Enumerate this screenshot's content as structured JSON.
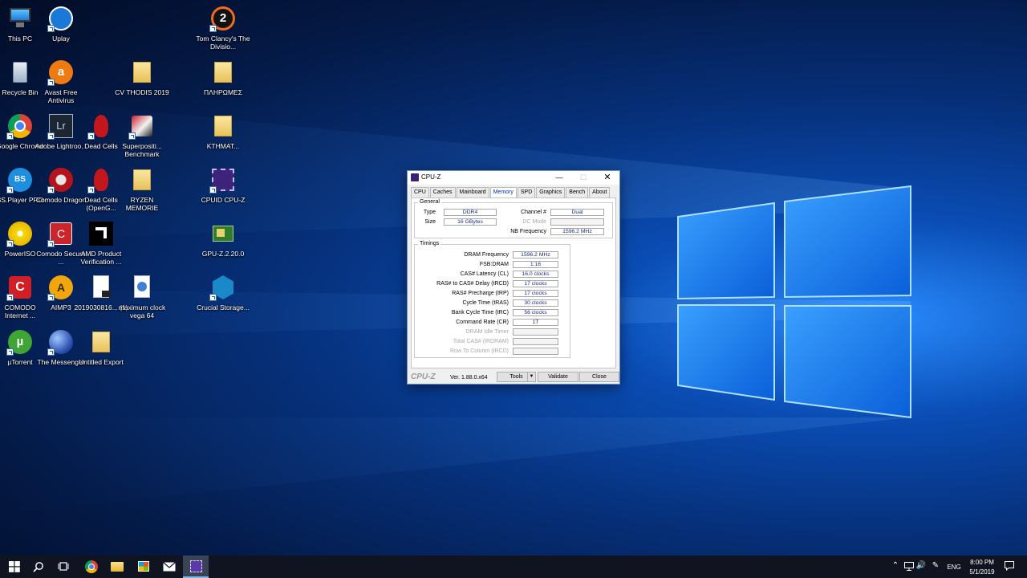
{
  "desktop": {
    "icons": [
      {
        "label": "This PC"
      },
      {
        "label": "Uplay"
      },
      {
        "label": "Tom Clancy's The Divisio..."
      },
      {
        "label": "Recycle Bin"
      },
      {
        "label": "Avast Free Antivirus"
      },
      {
        "label": "CV THODIS 2019"
      },
      {
        "label": "ΠΛΗΡΩΜΕΣ"
      },
      {
        "label": "Google Chrome"
      },
      {
        "label": "Adobe Lightroo..."
      },
      {
        "label": "Dead Cells"
      },
      {
        "label": "Superpositi... Benchmark"
      },
      {
        "label": "ΚΤΗΜΑΤ..."
      },
      {
        "label": "BS.Player PRO"
      },
      {
        "label": "Comodo Dragon"
      },
      {
        "label": "Dead Cells (OpenG..."
      },
      {
        "label": "RYZEN MEMORIE"
      },
      {
        "label": "CPUID CPU-Z"
      },
      {
        "label": "PowerISO"
      },
      {
        "label": "Comodo Secure ..."
      },
      {
        "label": "AMD Product Verification ..."
      },
      {
        "label": "GPU-Z.2.20.0"
      },
      {
        "label": "COMODO Internet ..."
      },
      {
        "label": "AIMP3"
      },
      {
        "label": "2019030816... (1)"
      },
      {
        "label": "maximum clock vega 64"
      },
      {
        "label": "Crucial Storage..."
      },
      {
        "label": "µTorrent"
      },
      {
        "label": "The Messenger"
      },
      {
        "label": "Untitled Export"
      }
    ]
  },
  "cpuz": {
    "title": "CPU-Z",
    "tabs": [
      "CPU",
      "Caches",
      "Mainboard",
      "Memory",
      "SPD",
      "Graphics",
      "Bench",
      "About"
    ],
    "active_tab": "Memory",
    "general": {
      "title": "General",
      "type_label": "Type",
      "type_value": "DDR4",
      "size_label": "Size",
      "size_value": "16 GBytes",
      "channel_label": "Channel #",
      "channel_value": "Dual",
      "dc_label": "DC Mode",
      "dc_value": "",
      "nb_label": "NB Frequency",
      "nb_value": "1596.2 MHz"
    },
    "timings": {
      "title": "Timings",
      "rows": [
        {
          "label": "DRAM Frequency",
          "value": "1596.2 MHz"
        },
        {
          "label": "FSB:DRAM",
          "value": "1:16"
        },
        {
          "label": "CAS# Latency (CL)",
          "value": "16.0 clocks"
        },
        {
          "label": "RAS# to CAS# Delay (tRCD)",
          "value": "17 clocks"
        },
        {
          "label": "RAS# Precharge (tRP)",
          "value": "17 clocks"
        },
        {
          "label": "Cycle Time (tRAS)",
          "value": "30 clocks"
        },
        {
          "label": "Bank Cycle Time (tRC)",
          "value": "56 clocks"
        },
        {
          "label": "Command Rate (CR)",
          "value": "1T"
        },
        {
          "label": "DRAM Idle Timer",
          "value": ""
        },
        {
          "label": "Total CAS# (tRDRAM)",
          "value": ""
        },
        {
          "label": "Row To Column (tRCD)",
          "value": ""
        }
      ]
    },
    "footer": {
      "logo": "CPU-Z",
      "version": "Ver. 1.88.0.x64",
      "tools_label": "Tools",
      "validate_label": "Validate",
      "close_label": "Close"
    }
  },
  "taskbar": {
    "language": "ENG",
    "time": "8:00 PM",
    "date": "5/1/2019"
  }
}
